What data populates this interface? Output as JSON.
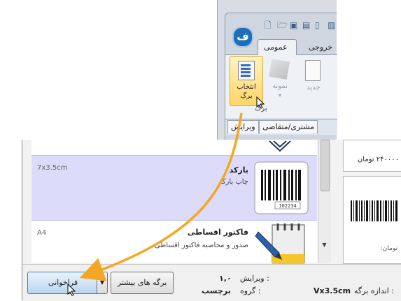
{
  "ribbon": {
    "tabs": [
      {
        "label": "عمومی",
        "active": true
      },
      {
        "label": "خروجی",
        "active": false
      }
    ],
    "buttons": {
      "select_label_line1": "انتخاب",
      "select_label_line2": "برگ",
      "sample_label": "نمونه",
      "new_label": "جدید"
    },
    "group_label": "برگ",
    "sub_tabs": [
      "مشتری/متقاضی",
      "ویرایش"
    ]
  },
  "list": {
    "items": [
      {
        "title": "بارکد",
        "description": "چاپ بارکد",
        "size": "7x3.5cm",
        "selected": true
      },
      {
        "title": "فاکتور اقساطی",
        "description": "صدور و محاصبه فاکتور اقساطی",
        "size": "A4",
        "selected": false
      }
    ]
  },
  "preview": {
    "price_text": "۲۴۰۰۰۰ تومان",
    "price_text_2": "تومان:"
  },
  "bottom": {
    "recall_label": "فراخوانی",
    "more_label": "برگه های بیشتر",
    "version_label": "ویرایش :",
    "version_value": "۱,۰",
    "group_label": "گروه :",
    "group_value": "برچسب",
    "size_label": "اندازه برگه :",
    "size_value": "Vx3.5cm"
  },
  "colors": {
    "selected_row": "#dcdcfa",
    "arrow": "#f5a623",
    "accent": "#3c7fb1"
  }
}
